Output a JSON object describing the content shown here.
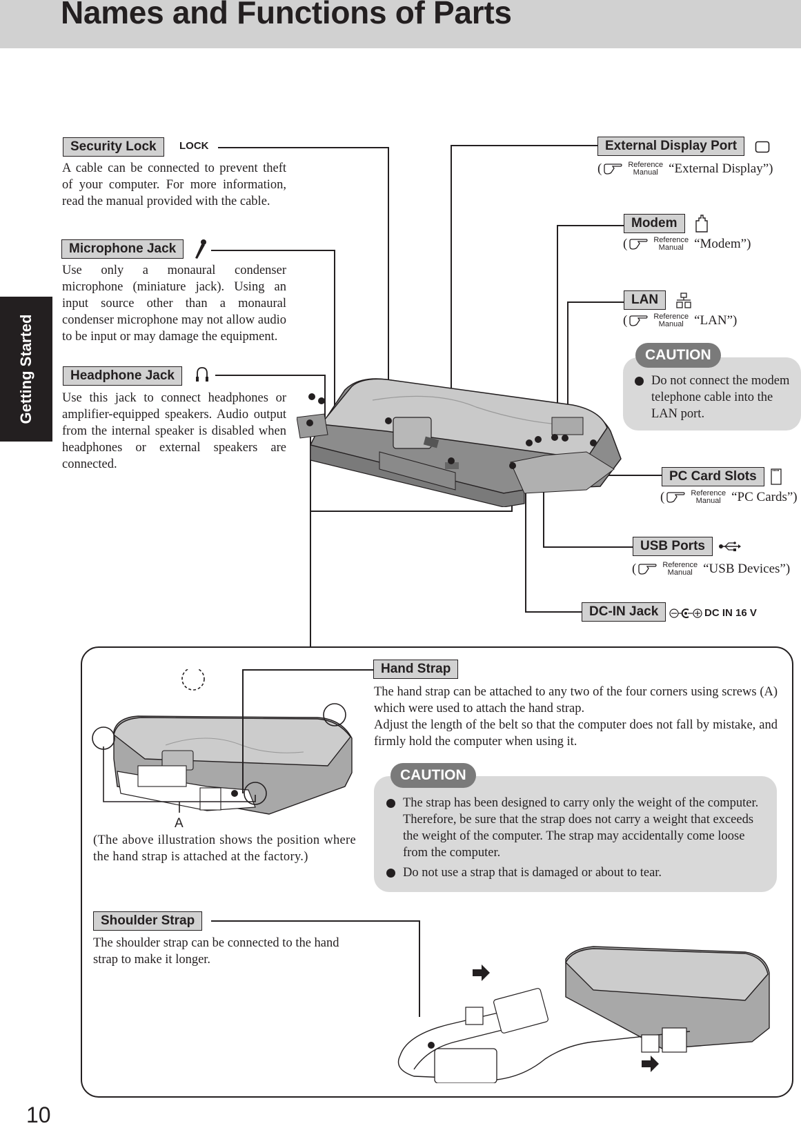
{
  "header": {
    "title": "Names and Functions of Parts"
  },
  "side_tab": {
    "label": "Getting Started"
  },
  "page_number": "10",
  "ref_manual": {
    "top": "Reference",
    "bottom": "Manual"
  },
  "parts": {
    "security_lock": {
      "label": "Security Lock",
      "symbol": "LOCK",
      "description": "A cable can be connected to prevent theft of your computer.  For more information, read the manual provided with the cable."
    },
    "microphone_jack": {
      "label": "Microphone Jack",
      "icon": "microphone-icon",
      "description": "Use only a monaural condenser microphone (miniature jack).  Using an input source other than a monaural condenser microphone may not allow audio to be input or may damage the equipment."
    },
    "headphone_jack": {
      "label": "Headphone Jack",
      "icon": "headphone-icon",
      "description": "Use this jack to connect  headphones or amplifier-equipped speakers. Audio output from the internal speaker is disabled when headphones or external speakers are connected."
    },
    "external_display_port": {
      "label": "External Display Port",
      "icon": "display-icon",
      "ref_open": "(",
      "ref_text": "“External Display”)"
    },
    "modem": {
      "label": "Modem",
      "icon": "modem-jack-icon",
      "ref_open": "(",
      "ref_text": "“Modem”)"
    },
    "lan": {
      "label": "LAN",
      "icon": "lan-network-icon",
      "ref_open": "(",
      "ref_text": "“LAN”)"
    },
    "pc_card_slots": {
      "label": "PC Card Slots",
      "icon": "pc-card-icon",
      "ref_open": "(",
      "ref_text": "“PC Cards”)"
    },
    "usb_ports": {
      "label": "USB Ports",
      "icon": "usb-icon",
      "ref_open": "(",
      "ref_text": "“USB Devices”)"
    },
    "dc_in_jack": {
      "label": "DC-IN Jack",
      "icon": "dc-polarity-icon",
      "symbol": "DC IN 16 V"
    }
  },
  "caution_lan": {
    "tag": "CAUTION",
    "items": [
      "Do not connect the modem telephone cable into the LAN port."
    ]
  },
  "hand_strap": {
    "label": "Hand Strap",
    "description_1": "The hand strap can be attached to any two of the four corners using screws (A) which were used to attach the hand strap.",
    "description_2": "Adjust the length of the belt so that the computer does not fall by mistake, and firmly hold the computer when using it.",
    "screw_marker": "A",
    "illustration_note": "(The above illustration shows the position where the hand strap is attached at the factory.)"
  },
  "caution_strap": {
    "tag": "CAUTION",
    "items": [
      "The strap has been designed to carry only the  weight of the computer. Therefore, be sure that the strap does not carry a weight that exceeds the weight of the computer. The strap may accidentally come loose from the computer.",
      "Do not use a strap that is damaged or about to tear."
    ]
  },
  "shoulder_strap": {
    "label": "Shoulder Strap",
    "description": "The shoulder strap can be connected to the hand strap to make it longer."
  },
  "colors": {
    "label_bg": "#d1d1d1",
    "header_bg": "#d1d1d1",
    "caution_tag": "#7a7a7a",
    "caution_box": "#d9d9d9",
    "ink": "#231f20"
  }
}
